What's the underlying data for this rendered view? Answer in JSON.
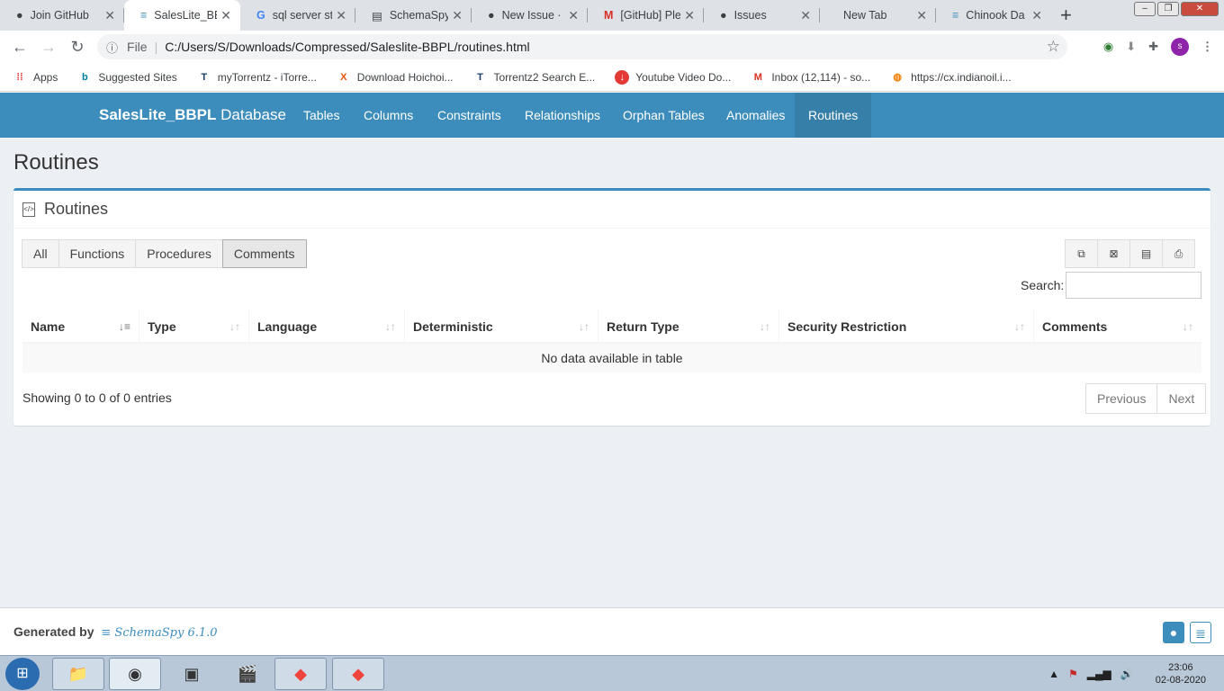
{
  "browser": {
    "tabs": [
      {
        "title": "Join GitHub",
        "icon": "github-icon",
        "active": false
      },
      {
        "title": "SalesLite_BB",
        "icon": "database-icon",
        "active": true
      },
      {
        "title": "sql server st",
        "icon": "google-icon",
        "active": false
      },
      {
        "title": "SchemaSpy",
        "icon": "schemaspy-icon",
        "active": false
      },
      {
        "title": "New Issue ·",
        "icon": "github-icon",
        "active": false
      },
      {
        "title": "[GitHub] Ple",
        "icon": "gmail-icon",
        "active": false
      },
      {
        "title": "Issues",
        "icon": "github-icon",
        "active": false
      },
      {
        "title": "New Tab",
        "icon": "",
        "active": false
      },
      {
        "title": "Chinook Da",
        "icon": "database-icon",
        "active": false
      }
    ],
    "address": {
      "scheme": "File",
      "url": "C:/Users/S/Downloads/Compressed/Saleslite-BBPL/routines.html"
    },
    "avatar_letter": "s",
    "bookmarks": [
      {
        "label": "Apps",
        "icon": "apps-grid-icon"
      },
      {
        "label": "Suggested Sites",
        "icon": "bing-icon"
      },
      {
        "label": "myTorrentz - iTorre...",
        "icon": "torrentz-icon"
      },
      {
        "label": "Download Hoichoi...",
        "icon": "x-logo-icon"
      },
      {
        "label": "Torrentz2 Search E...",
        "icon": "torrentz-icon"
      },
      {
        "label": "Youtube Video Do...",
        "icon": "download-icon"
      },
      {
        "label": "Inbox (12,114) - so...",
        "icon": "gmail-icon"
      },
      {
        "label": "https://cx.indianoil.i...",
        "icon": "indianoil-icon"
      }
    ]
  },
  "navbar": {
    "brand_bold": "SalesLite_BBPL",
    "brand_rest": "Database",
    "items": [
      "Tables",
      "Columns",
      "Constraints",
      "Relationships",
      "Orphan Tables",
      "Anomalies",
      "Routines"
    ],
    "active": "Routines"
  },
  "page": {
    "title": "Routines",
    "box_title": "Routines",
    "filters": [
      "All",
      "Functions",
      "Procedures",
      "Comments"
    ],
    "active_filter": "Comments",
    "search_label": "Search:",
    "columns": [
      "Name",
      "Type",
      "Language",
      "Deterministic",
      "Return Type",
      "Security Restriction",
      "Comments"
    ],
    "empty_text": "No data available in table",
    "entries_info": "Showing 0 to 0 of 0 entries",
    "pager": [
      "Previous",
      "Next"
    ]
  },
  "footer": {
    "generated_by": "Generated by",
    "tool_name": "SchemaSpy 6.1.0"
  },
  "taskbar": {
    "time": "23:06",
    "date": "02-08-2020"
  }
}
